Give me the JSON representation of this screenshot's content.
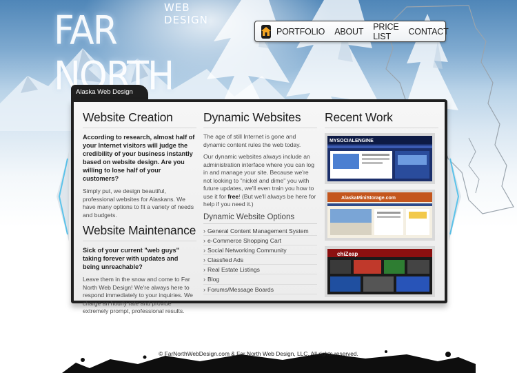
{
  "logo": {
    "small": "WEB DESIGN",
    "big": "FAR NORTH"
  },
  "nav": {
    "home_icon": "house-icon",
    "items": [
      "PORTFOLIO",
      "ABOUT",
      "PRICE LIST",
      "CONTACT"
    ]
  },
  "panel": {
    "tab_label": "Alaska Web Design",
    "creation": {
      "title": "Website Creation",
      "lead": "According to research, almost half of your Internet visitors will judge the credibility of your business instantly based on website design. Are you willing to lose half of your customers?",
      "body": "Simply put, we design beautiful, professional websites for Alaskans. We have many options to fit a variety of needs and budgets."
    },
    "maintenance": {
      "title": "Website Maintenance",
      "lead": "Sick of your current \"web guys\" taking forever with updates and being unreachable?",
      "body": "Leave them in the snow and come to Far North Web Design! We're always here to respond immediately to your inquiries. We charge an hourly rate and provide extremely prompt, professional results."
    },
    "dynamic": {
      "title": "Dynamic Websites",
      "p1": "The age of still Internet is gone and dynamic content rules the web today.",
      "p2_a": "Our dynamic websites always include an administration interface where you can log in and manage your site. Because we're not looking to \"nickel and dime\" you with future updates, we'll even train you how to use it for ",
      "p2_b": "free",
      "p2_c": "! (But we'll always be here for help if you need it.)",
      "options_title": "Dynamic Website Options",
      "options": [
        "General Content Management System",
        "e-Commerce Shopping Cart",
        "Social Networking Community",
        "Classfied Ads",
        "Real Estate Listings",
        "Blog",
        "Forums/Message Boards"
      ]
    },
    "recent": {
      "title": "Recent Work",
      "thumbs": [
        {
          "label": "MYSOCIALENGINE"
        },
        {
          "label": "AlaskaMiniStorage.com"
        },
        {
          "label": "chiZeap"
        }
      ]
    }
  },
  "footer": {
    "text": "© FarNorthWebDesign.com & Far North Web Design, LLC. All rights reserved."
  },
  "colors": {
    "panel_frame": "#1f1f1f",
    "panel_bg": "#f2f2f2",
    "accent_blue": "#7fd0f0"
  }
}
